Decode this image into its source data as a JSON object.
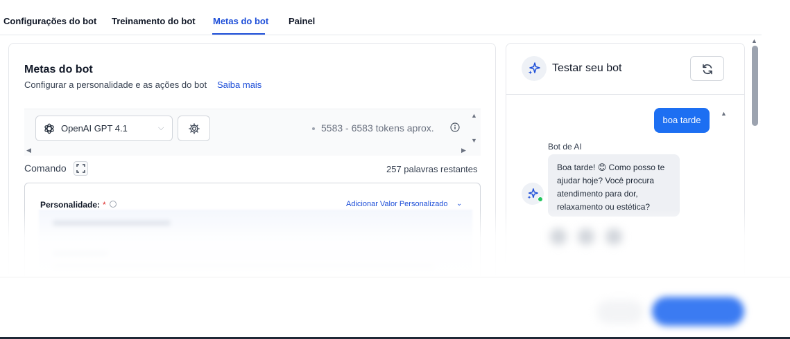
{
  "tabs": [
    {
      "label": "Configurações do bot"
    },
    {
      "label": "Treinamento do bot"
    },
    {
      "label": "Metas do bot",
      "active": true
    },
    {
      "label": "Painel"
    }
  ],
  "goals": {
    "title": "Metas do bot",
    "subtitle": "Configurar a personalidade e as ações do bot",
    "learn_more": "Saiba mais",
    "model": {
      "selected": "OpenAI GPT 4.1",
      "icon": "openai-icon",
      "settings_icon": "gear-icon",
      "tokens": "5583 - 6583 tokens aprox."
    },
    "command": {
      "label": "Comando",
      "words_left": "257 palavras restantes"
    },
    "personality": {
      "label": "Personalidade:",
      "required_mark": "*",
      "add_custom": "Adicionar Valor Personalizado"
    }
  },
  "test_bot": {
    "title": "Testar seu bot",
    "icon": "sparkle-icon",
    "refresh_icon": "refresh-icon",
    "messages": [
      {
        "from": "user",
        "text": "boa tarde"
      },
      {
        "from": "bot",
        "name": "Bot de AI",
        "text": "Boa tarde! 😊 Como posso te ajudar hoje? Você procura atendimento para dor, relaxamento ou estética?"
      }
    ]
  },
  "colors": {
    "accent": "#1d4ed8",
    "user_bubble": "#1d6ff2",
    "online": "#22c55e"
  }
}
